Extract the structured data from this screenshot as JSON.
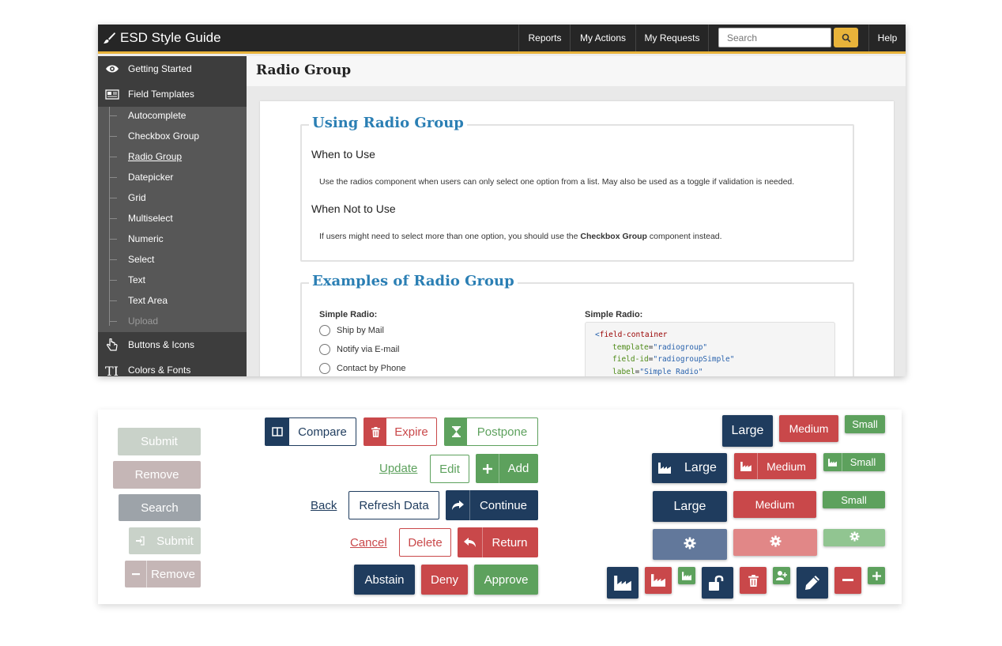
{
  "header": {
    "brand": "ESD Style Guide",
    "nav": [
      "Reports",
      "My Actions",
      "My Requests"
    ],
    "search_placeholder": "Search",
    "help": "Help"
  },
  "sidebar": {
    "main": [
      "Getting Started",
      "Field Templates",
      "Buttons & Icons",
      "Colors & Fonts"
    ],
    "sub": [
      "Autocomplete",
      "Checkbox Group",
      "Radio Group",
      "Datepicker",
      "Grid",
      "Multiselect",
      "Numeric",
      "Select",
      "Text",
      "Text Area",
      "Upload"
    ]
  },
  "page": {
    "title": "Radio Group",
    "section1": {
      "legend": "Using Radio Group",
      "when_title": "When to Use",
      "when_text": "Use the radios component when users can only select one option from a list. May also be used as a toggle if validation is needed.",
      "not_title": "When Not to Use",
      "not_pre": "If users might need to select more than one option, you should use the ",
      "not_bold": "Checkbox Group",
      "not_post": " component instead."
    },
    "section2": {
      "legend": "Examples of Radio Group",
      "example_label": "Simple Radio:",
      "options": [
        "Ship by Mail",
        "Notify via E-mail",
        "Contact by Phone"
      ],
      "code_label": "Simple Radio:",
      "code": {
        "tag": "field-container",
        "lt": "<",
        "attrs": [
          {
            "name": "template",
            "value": "\"radiogroup\""
          },
          {
            "name": "field-id",
            "value": "\"radiogroupSimple\""
          },
          {
            "name": "label",
            "value": "\"Simple Radio\""
          }
        ]
      }
    }
  },
  "panel": {
    "disabled": [
      "Submit",
      "Remove",
      "Search",
      "Submit",
      "Remove"
    ],
    "row1": [
      "Compare",
      "Expire",
      "Postpone"
    ],
    "row2": {
      "link": "Update",
      "edit": "Edit",
      "add": "Add"
    },
    "row3": {
      "link": "Back",
      "refresh": "Refresh Data",
      "continue": "Continue"
    },
    "row4": {
      "link": "Cancel",
      "delete": "Delete",
      "return": "Return"
    },
    "row5": [
      "Abstain",
      "Deny",
      "Approve"
    ],
    "sizes": {
      "large": "Large",
      "medium": "Medium",
      "small": "Small"
    }
  },
  "colors": {
    "navy": "#1f3c5e",
    "red": "#c9484a",
    "green": "#5da15d",
    "accent": "#e8b33a",
    "link_blue": "#2b7fb4"
  }
}
